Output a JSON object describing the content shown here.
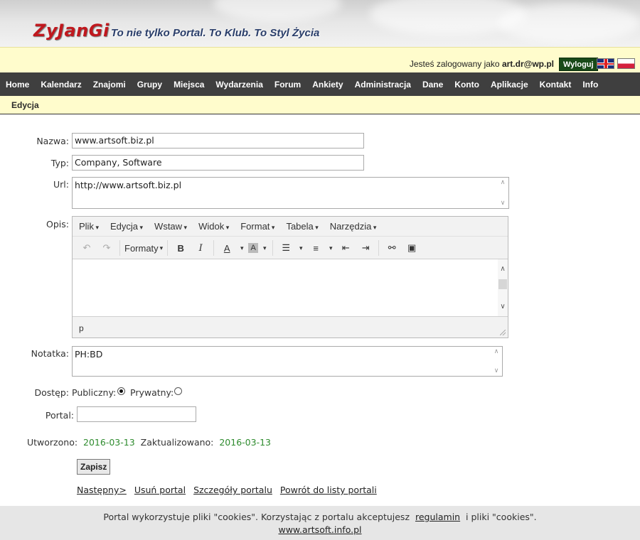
{
  "header": {
    "logo": "ZyJanGi",
    "slogan": "To nie tylko Portal. To Klub. To Styl Życia"
  },
  "userbar": {
    "logged_as": "Jesteś zalogowany jako",
    "user": "art.dr@wp.pl",
    "logout": "Wyloguj"
  },
  "nav": [
    "Home",
    "Kalendarz",
    "Znajomi",
    "Grupy",
    "Miejsca",
    "Wydarzenia",
    "Forum",
    "Ankiety",
    "Administracja",
    "Dane",
    "Konto",
    "Aplikacje",
    "Kontakt",
    "Info"
  ],
  "subbar": {
    "title": "Edycja"
  },
  "form": {
    "name_label": "Nazwa:",
    "name_value": "www.artsoft.biz.pl",
    "type_label": "Typ:",
    "type_value": "Company, Software",
    "url_label": "Url:",
    "url_value": "http://www.artsoft.biz.pl",
    "desc_label": "Opis:",
    "note_label": "Notatka:",
    "note_value": "PH:BD",
    "access_label": "Dostęp:",
    "public_label": "Publiczny:",
    "private_label": "Prywatny:",
    "access_selected": "Publiczny",
    "portal_label": "Portal:",
    "portal_value": "",
    "created_label": "Utworzono:",
    "created_value": "2016-03-13",
    "updated_label": "Zaktualizowano:",
    "updated_value": "2016-03-13",
    "save": "Zapisz"
  },
  "editor": {
    "menu": [
      "Plik",
      "Edycja",
      "Wstaw",
      "Widok",
      "Format",
      "Tabela",
      "Narzędzia"
    ],
    "formats": "Formaty",
    "path": "p"
  },
  "links": {
    "next": "Następny>",
    "delete": "Usuń portal",
    "details": "Szczegóły portalu",
    "back": "Powrót do listy portali"
  },
  "footer": {
    "text_before": "Portal wykorzystuje pliki \"cookies\". Korzystając z portalu akceptujesz",
    "terms": "regulamin",
    "text_after": "i pliki \"cookies\".",
    "site": "www.artsoft.info.pl"
  }
}
